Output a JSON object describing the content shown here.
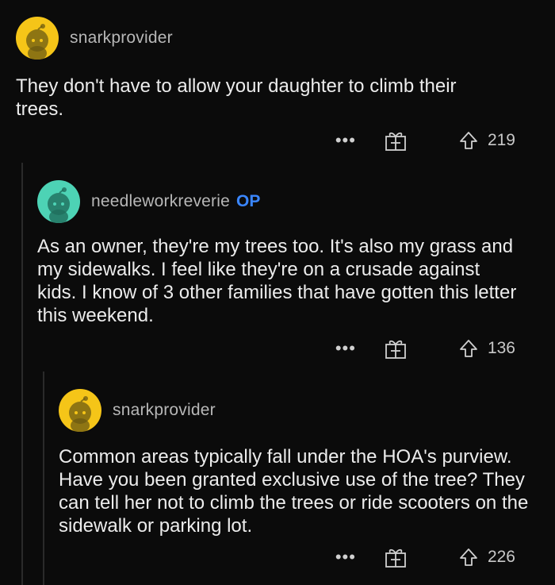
{
  "comments": [
    {
      "username": "snarkprovider",
      "op_badge": "",
      "avatar_color": "#f5c518",
      "body": "They don't have to allow your daughter to climb their trees.",
      "menu_label": "•••",
      "upvotes": "219"
    },
    {
      "username": "needleworkreverie",
      "op_badge": "OP",
      "avatar_color": "#4dd3b5",
      "body": "As an owner, they're my trees too. It's also my grass and my sidewalks. I feel like they're on a crusade against kids. I know of 3 other families that have gotten this letter this weekend.",
      "menu_label": "•••",
      "upvotes": "136"
    },
    {
      "username": "snarkprovider",
      "op_badge": "",
      "avatar_color": "#f5c518",
      "body": "Common areas typically fall under the HOA's purview. Have you been granted exclusive use of the tree? They can tell her not to climb the trees or ride scooters on the sidewalk or parking lot.",
      "menu_label": "•••",
      "upvotes": "226"
    }
  ],
  "icons": {
    "avatar": "snoo-avatar-icon",
    "gift": "gift-award-icon",
    "upvote": "upvote-arrow-icon",
    "more": "more-options-icon"
  },
  "colors": {
    "background": "#0b0b0b",
    "op_badge": "#3a86ff",
    "thread_line": "#2a2a2a"
  }
}
